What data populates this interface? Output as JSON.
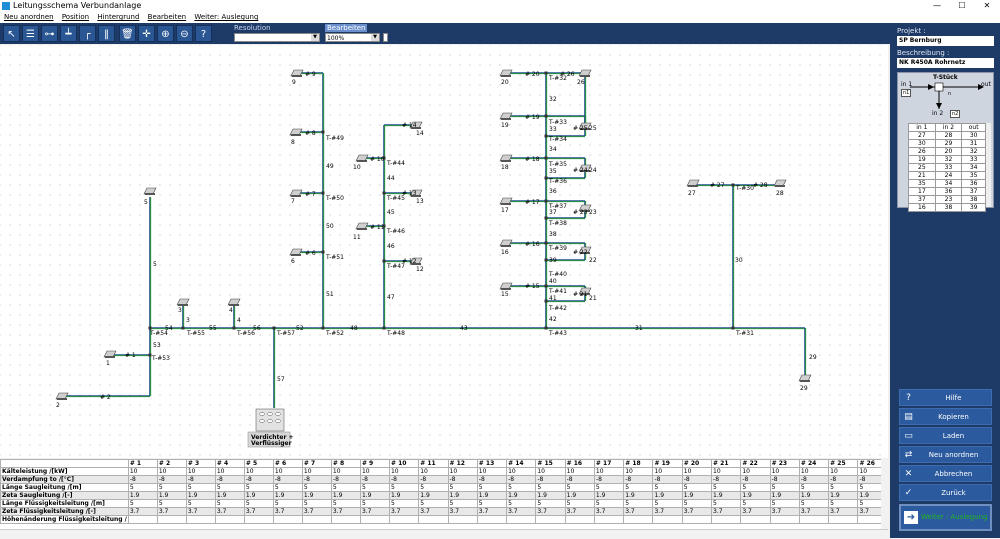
{
  "window": {
    "title": "Leitungsschema Verbundanlage",
    "controls": [
      "—",
      "☐",
      "✕"
    ]
  },
  "menu": [
    "Neu anordnen",
    "Position",
    "Hintergrund",
    "Bearbeiten",
    "Weiter: Auslegung"
  ],
  "toolbar": {
    "resolution_label": "Resolution",
    "resolution_value": "",
    "bearbeiten_label": "Bearbeiten",
    "zoom_value": "100%"
  },
  "sidebar": {
    "projekt_label": "Projekt :",
    "projekt_value": "SP Bernburg",
    "beschreibung_label": "Beschreibung :",
    "beschreibung_value": "NK R450A Rohrnetz",
    "tstueck_title": "T-Stück",
    "tstueck_in1": "in 1",
    "tstueck_in2": "in 2",
    "tstueck_out": "out",
    "tstueck_n1": "n1",
    "tstueck_n2": "n2",
    "tstueck_n": "n",
    "table_headers": [
      "in 1",
      "in 2",
      "out"
    ],
    "table_rows": [
      [
        "27",
        "28",
        "30"
      ],
      [
        "30",
        "29",
        "31"
      ],
      [
        "26",
        "20",
        "32"
      ],
      [
        "19",
        "32",
        "33"
      ],
      [
        "25",
        "33",
        "34"
      ],
      [
        "21",
        "24",
        "35"
      ],
      [
        "35",
        "34",
        "36"
      ],
      [
        "17",
        "36",
        "37"
      ],
      [
        "37",
        "23",
        "38"
      ],
      [
        "16",
        "38",
        "39"
      ]
    ],
    "buttons": [
      {
        "icon": "?",
        "label": "Hilfe"
      },
      {
        "icon": "▤",
        "label": "Kopieren"
      },
      {
        "icon": "▭",
        "label": "Laden"
      },
      {
        "icon": "⇄",
        "label": "Neu anordnen"
      },
      {
        "icon": "✕",
        "label": "Abbrechen"
      },
      {
        "icon": "✓",
        "label": "Zurück"
      }
    ],
    "weiter_label": "Weiter : Auslegung",
    "weiter_color": "#22b422"
  },
  "schema": {
    "compressor_label_1": "Verdichter +",
    "compressor_label_2": "Verflüssiger",
    "nodes": [
      "9",
      "8",
      "7",
      "6",
      "14",
      "10",
      "13",
      "11",
      "12",
      "20",
      "26",
      "19",
      "25",
      "18",
      "24",
      "17",
      "23",
      "16",
      "22",
      "15",
      "21",
      "5",
      "1",
      "2",
      "3",
      "4",
      "27",
      "28",
      "29",
      "T-#49",
      "T-#50",
      "T-#51",
      "T-#52",
      "T-#44",
      "T-#45",
      "T-#46",
      "T-#47",
      "T-#48",
      "T-#32",
      "T-#33",
      "T-#34",
      "T-#35",
      "T-#36",
      "T-#37",
      "T-#38",
      "T-#39",
      "T-#40",
      "T-#41",
      "T-#42",
      "T-#43",
      "T-#54",
      "T-#53",
      "T-#55",
      "T-#56",
      "T-#57",
      "T-#30",
      "T-#31",
      "# 9",
      "# 8",
      "# 7",
      "# 6",
      "# 14",
      "# 10",
      "# 13",
      "# 11",
      "# 12",
      "# 20",
      "# 26",
      "# 19",
      "# 25",
      "# 18",
      "# 24",
      "# 17",
      "# 23",
      "# 16",
      "# 22",
      "# 15",
      "# 21",
      "# 1",
      "# 2",
      "# 27",
      "# 28",
      "49",
      "50",
      "51",
      "52",
      "44",
      "45",
      "46",
      "47",
      "48",
      "32",
      "33",
      "34",
      "35",
      "36",
      "37",
      "38",
      "39",
      "40",
      "41",
      "42",
      "43",
      "53",
      "54",
      "55",
      "56",
      "57",
      "30",
      "31",
      "5",
      "3",
      "4",
      "29"
    ]
  },
  "grid": {
    "columns": [
      "# 1",
      "# 2",
      "# 3",
      "# 4",
      "# 5",
      "# 6",
      "# 7",
      "# 8",
      "# 9",
      "# 10",
      "# 11",
      "# 12",
      "# 13",
      "# 14",
      "# 15",
      "# 16",
      "# 17",
      "# 18",
      "# 19",
      "# 20",
      "# 21",
      "# 22",
      "# 23",
      "# 24",
      "# 25",
      "# 26"
    ],
    "rows": [
      {
        "label": "Kälteleistung /[kW]",
        "values": [
          "10",
          "10",
          "10",
          "10",
          "10",
          "10",
          "10",
          "10",
          "10",
          "10",
          "10",
          "10",
          "10",
          "10",
          "10",
          "10",
          "10",
          "10",
          "10",
          "10",
          "10",
          "10",
          "10",
          "10",
          "10",
          "10"
        ]
      },
      {
        "label": "Verdampfung to /[°C]",
        "values": [
          "-8",
          "-8",
          "-8",
          "-8",
          "-8",
          "-8",
          "-8",
          "-8",
          "-8",
          "-8",
          "-8",
          "-8",
          "-8",
          "-8",
          "-8",
          "-8",
          "-8",
          "-8",
          "-8",
          "-8",
          "-8",
          "-8",
          "-8",
          "-8",
          "-8",
          "-8"
        ]
      },
      {
        "label": "Länge Saugleitung /[m]",
        "values": [
          "5",
          "5",
          "5",
          "5",
          "5",
          "5",
          "5",
          "5",
          "5",
          "5",
          "5",
          "5",
          "5",
          "5",
          "5",
          "5",
          "5",
          "5",
          "5",
          "5",
          "5",
          "5",
          "5",
          "5",
          "5",
          "5"
        ]
      },
      {
        "label": "Zeta Saugleitung /[-]",
        "values": [
          "1.9",
          "1.9",
          "1.9",
          "1.9",
          "1.9",
          "1.9",
          "1.9",
          "1.9",
          "1.9",
          "1.9",
          "1.9",
          "1.9",
          "1.9",
          "1.9",
          "1.9",
          "1.9",
          "1.9",
          "1.9",
          "1.9",
          "1.9",
          "1.9",
          "1.9",
          "1.9",
          "1.9",
          "1.9",
          "1.9"
        ]
      },
      {
        "label": "Länge Flüssigkeitsleitung /[m]",
        "values": [
          "5",
          "5",
          "5",
          "5",
          "5",
          "5",
          "5",
          "5",
          "5",
          "5",
          "5",
          "5",
          "5",
          "5",
          "5",
          "5",
          "5",
          "5",
          "5",
          "5",
          "5",
          "5",
          "5",
          "5",
          "5",
          "5"
        ]
      },
      {
        "label": "Zeta Flüssigkeitsleitung /[-]",
        "values": [
          "3.7",
          "3.7",
          "3.7",
          "3.7",
          "3.7",
          "3.7",
          "3.7",
          "3.7",
          "3.7",
          "3.7",
          "3.7",
          "3.7",
          "3.7",
          "3.7",
          "3.7",
          "3.7",
          "3.7",
          "3.7",
          "3.7",
          "3.7",
          "3.7",
          "3.7",
          "3.7",
          "3.7",
          "3.7",
          "3.7"
        ]
      },
      {
        "label": "Höhenänderung Flüssigkeitsleitung /",
        "values": [
          "",
          "",
          "",
          "",
          "",
          "",
          "",
          "",
          "",
          "",
          "",
          "",
          "",
          "",
          "",
          "",
          "",
          "",
          "",
          "",
          "",
          "",
          "",
          "",
          "",
          ""
        ]
      }
    ]
  }
}
